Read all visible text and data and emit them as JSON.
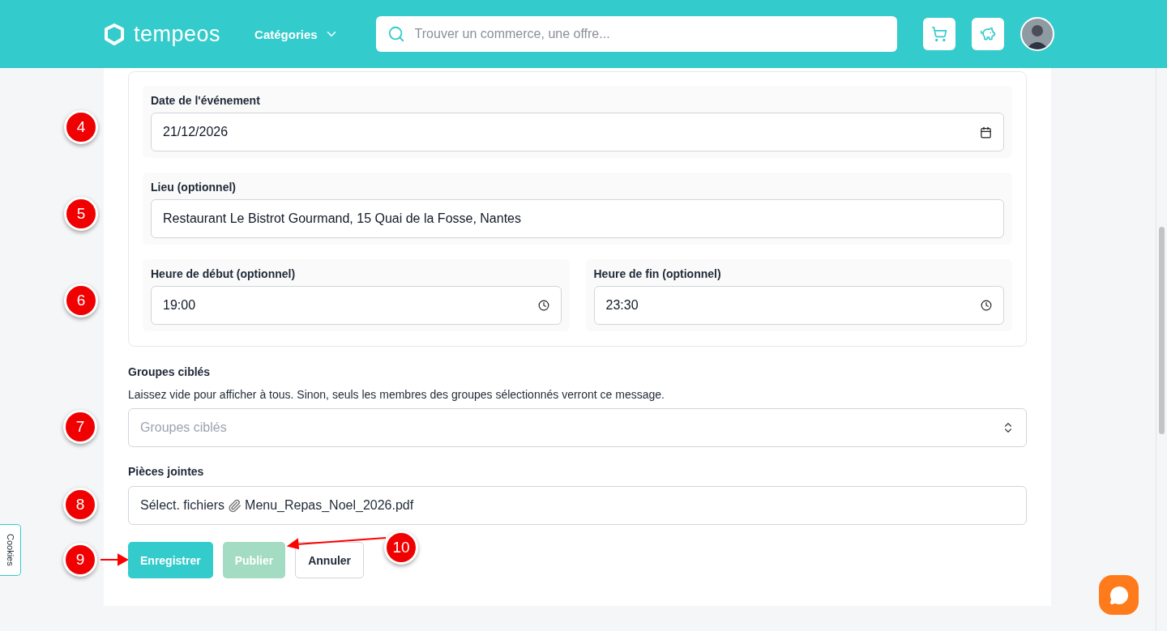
{
  "header": {
    "logo": "tempeos",
    "categories": "Catégories",
    "search": {
      "placeholder": "Trouver un commerce, une offre..."
    }
  },
  "event_group": {
    "rows": [
      {
        "fields": [
          {
            "label": "Date de l'événement",
            "value": "21/12/2026",
            "kind": "date"
          }
        ],
        "annotation": "4"
      },
      {
        "fields": [
          {
            "label": "Lieu (optionnel)",
            "value": "Restaurant Le Bistrot Gourmand, 15 Quai de la Fosse, Nantes",
            "kind": "text"
          }
        ],
        "annotation": "5"
      },
      {
        "fields": [
          {
            "label": "Heure de début (optionnel)",
            "value": "19:00",
            "kind": "time"
          },
          {
            "label": "Heure de fin (optionnel)",
            "value": "23:30",
            "kind": "time"
          }
        ],
        "annotation": "6"
      }
    ]
  },
  "groups": {
    "label": "Groupes ciblés",
    "help": "Laissez vide pour afficher à tous. Sinon, seuls les membres des groupes sélectionnés verront ce message.",
    "placeholder": "Groupes ciblés",
    "annotation": "7"
  },
  "attachments": {
    "label": "Pièces jointes",
    "button": "Sélect. fichiers",
    "file": "Menu_Repas_Noel_2026.pdf",
    "annotation": "8"
  },
  "buttons": [
    {
      "label": "Enregistrer",
      "kind": "primary",
      "disabled": false,
      "annotation": "9"
    },
    {
      "label": "Publier",
      "kind": "primary",
      "disabled": true,
      "annotation": "10"
    },
    {
      "label": "Annuler",
      "kind": "outline",
      "disabled": false
    }
  ],
  "cookies_tab": "Cookies"
}
